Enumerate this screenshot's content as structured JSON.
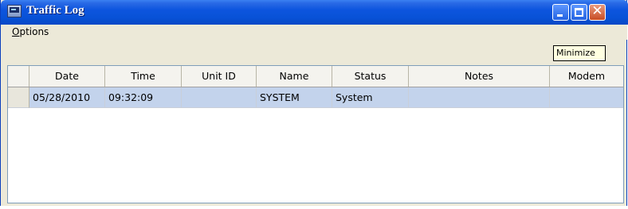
{
  "window": {
    "title": "Traffic Log",
    "colors": {
      "titlebar": "#0852d7",
      "close_button": "#c84d24",
      "selection": "#c3d3ec"
    }
  },
  "menu": {
    "options_label_first": "O",
    "options_label_rest": "ptions"
  },
  "tooltip": {
    "text": "Minimize"
  },
  "table": {
    "headers": [
      "Date",
      "Time",
      "Unit ID",
      "Name",
      "Status",
      "Notes",
      "Modem"
    ],
    "rows": [
      {
        "date": "05/28/2010",
        "time": "09:32:09",
        "unit_id": "",
        "name": "SYSTEM",
        "status": "System",
        "notes": "",
        "modem": ""
      }
    ]
  },
  "icons": {
    "app": "terminal-icon",
    "minimize": "minimize-icon",
    "maximize": "maximize-icon",
    "close": "close-icon"
  }
}
